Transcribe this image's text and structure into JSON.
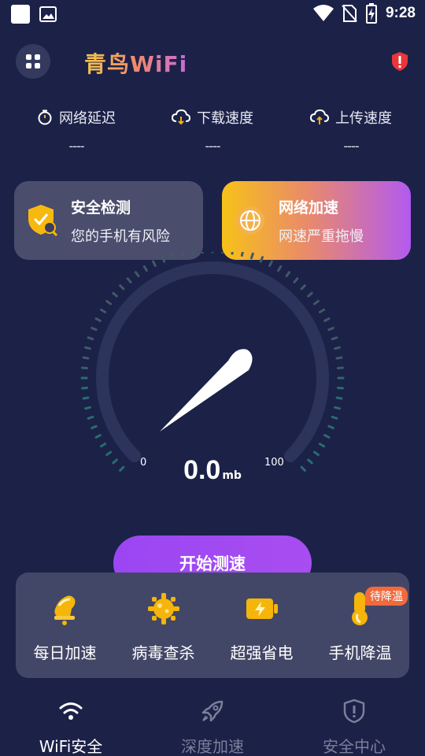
{
  "status_bar": {
    "time": "9:28"
  },
  "app": {
    "title": "青鸟WiFi"
  },
  "stats": [
    {
      "label": "网络延迟",
      "value": "----",
      "icon": "timer-icon"
    },
    {
      "label": "下载速度",
      "value": "----",
      "icon": "cloud-download-icon"
    },
    {
      "label": "上传速度",
      "value": "----",
      "icon": "cloud-upload-icon"
    }
  ],
  "cards": {
    "security": {
      "title": "安全检测",
      "subtitle": "您的手机有风险"
    },
    "accelerate": {
      "title": "网络加速",
      "subtitle": "网速严重拖慢"
    }
  },
  "gauge": {
    "min": "0",
    "max": "100",
    "value": "0.0",
    "unit": "mb"
  },
  "start_button": "开始测速",
  "tools": [
    {
      "label": "每日加速",
      "icon": "bell-icon"
    },
    {
      "label": "病毒查杀",
      "icon": "virus-gear-icon"
    },
    {
      "label": "超强省电",
      "icon": "battery-icon"
    },
    {
      "label": "手机降温",
      "icon": "thermometer-icon",
      "badge": "待降温"
    }
  ],
  "nav": [
    {
      "label": "WiFi安全",
      "icon": "wifi-icon",
      "active": true
    },
    {
      "label": "深度加速",
      "icon": "rocket-icon",
      "active": false
    },
    {
      "label": "安全中心",
      "icon": "shield-icon",
      "active": false
    }
  ],
  "colors": {
    "background": "#1c2148",
    "accent_purple": "#9b46f3",
    "accent_yellow": "#f7c218",
    "badge_orange": "#f26a3c"
  }
}
